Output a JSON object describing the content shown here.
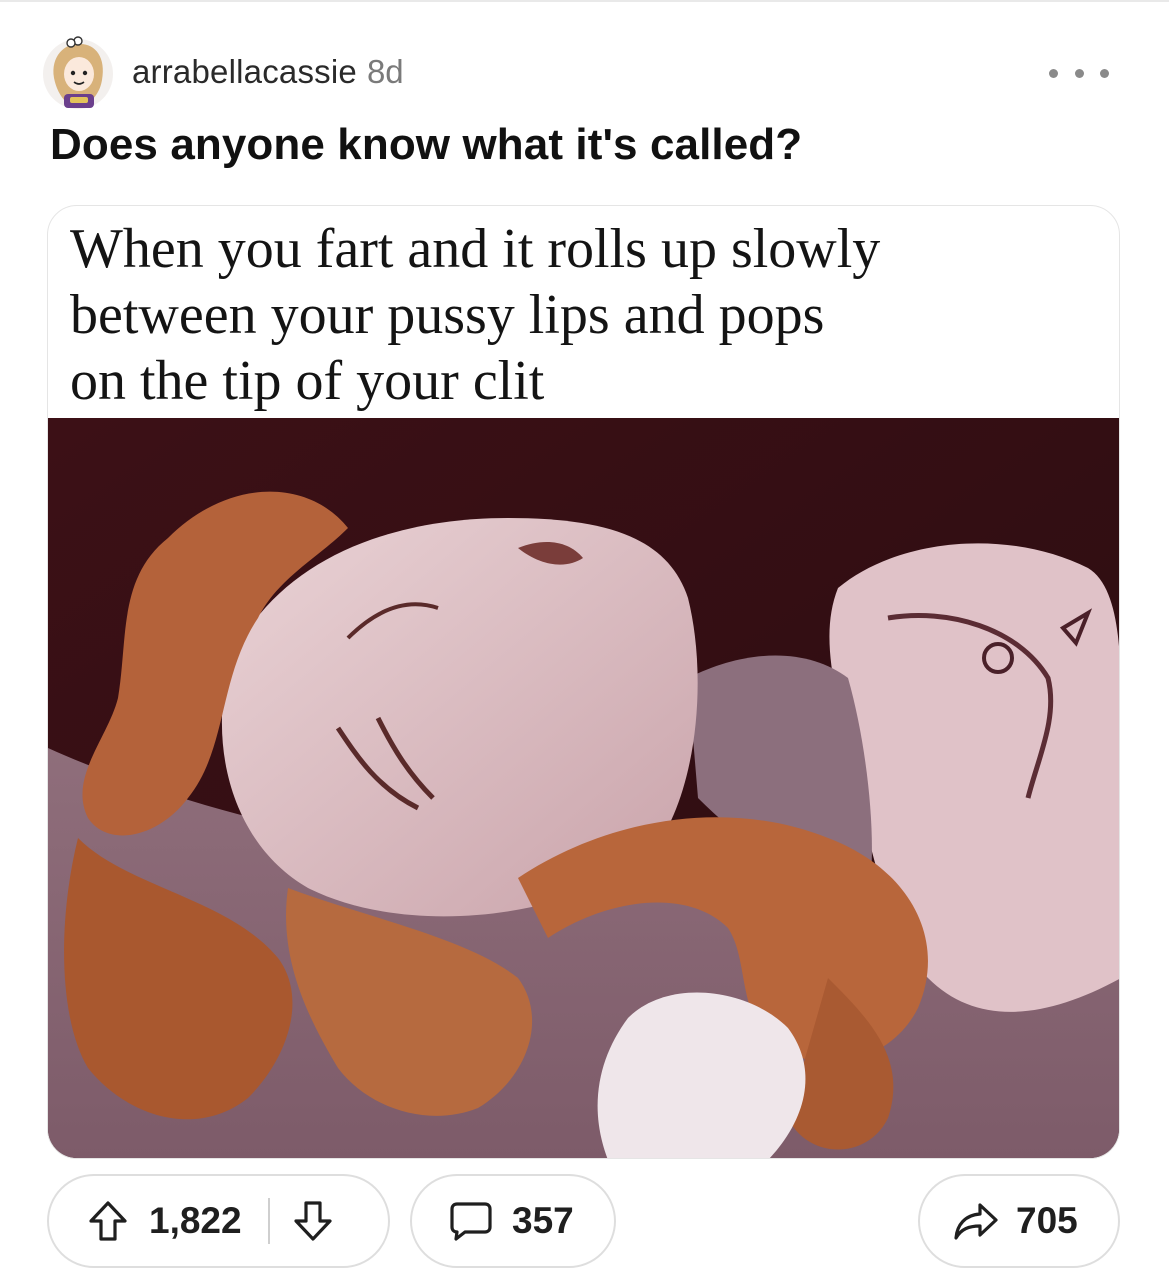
{
  "post": {
    "author": "arrabellacassie",
    "age": "8d",
    "title": "Does anyone know what it's called?",
    "media": {
      "caption_lines": [
        "When you fart and it rolls up slowly",
        "between your pussy lips and pops",
        "on the tip of your clit"
      ]
    }
  },
  "actions": {
    "upvotes": "1,822",
    "comments": "357",
    "shares": "705"
  },
  "icons": {
    "upvote": "arrow-up-icon",
    "downvote": "arrow-down-icon",
    "comment": "speech-bubble-icon",
    "share": "share-arrow-icon",
    "more": "ellipsis-icon"
  },
  "colors": {
    "text": "#1a1a1b",
    "muted": "#7a7a7a",
    "border": "#dedede",
    "hair": "#b5663a",
    "background_dark": "#3a1318",
    "skin": "#e7cdd1"
  }
}
